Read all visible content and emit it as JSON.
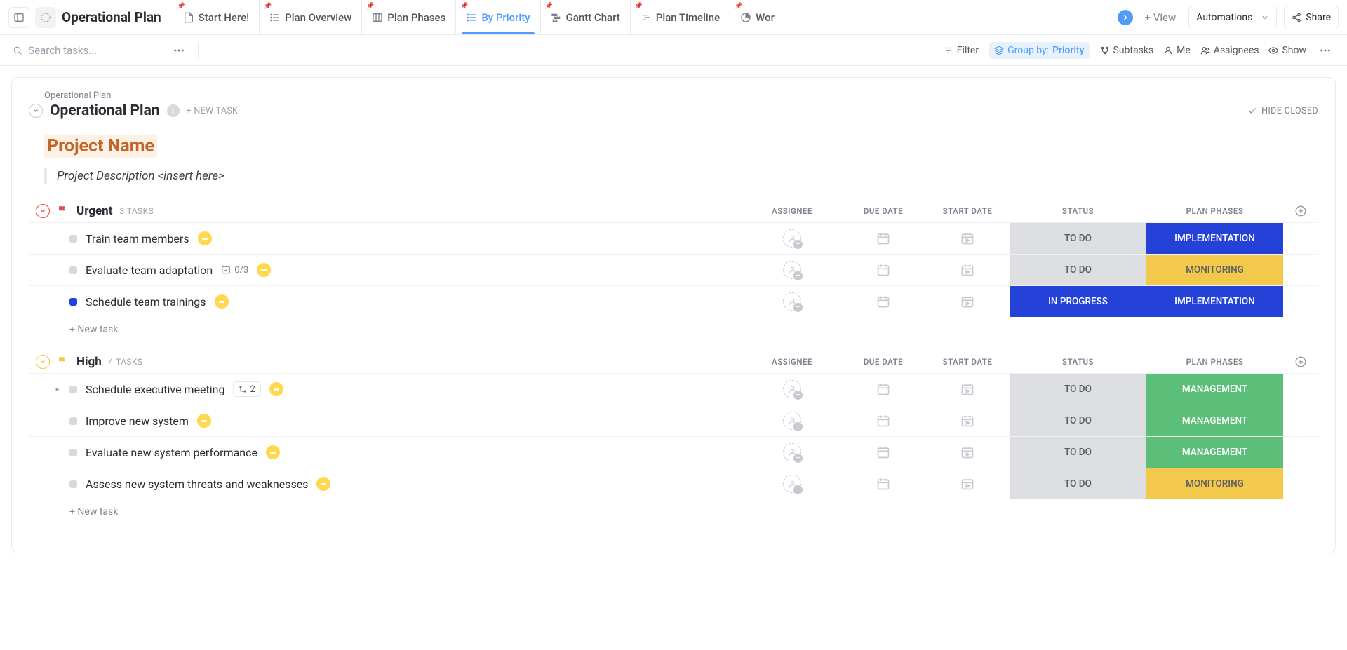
{
  "space_title": "Operational Plan",
  "tabs": [
    {
      "label": "Start Here!"
    },
    {
      "label": "Plan Overview"
    },
    {
      "label": "Plan Phases"
    },
    {
      "label": "By Priority"
    },
    {
      "label": "Gantt Chart"
    },
    {
      "label": "Plan Timeline"
    },
    {
      "label": "Wor"
    }
  ],
  "view_add": "View",
  "automations": "Automations",
  "share": "Share",
  "search_placeholder": "Search tasks...",
  "toolbar": {
    "filter": "Filter",
    "group_by_label": "Group by:",
    "group_by_value": "Priority",
    "subtasks": "Subtasks",
    "me": "Me",
    "assignees": "Assignees",
    "show": "Show"
  },
  "breadcrumb": "Operational Plan",
  "list_title": "Operational Plan",
  "new_task_header": "+ NEW TASK",
  "hide_closed": "HIDE CLOSED",
  "project_name": "Project Name",
  "project_desc": "Project Description <insert here>",
  "columns": {
    "assignee": "ASSIGNEE",
    "due": "DUE DATE",
    "start": "START DATE",
    "status": "STATUS",
    "phase": "PLAN PHASES"
  },
  "groups": [
    {
      "id": "urgent",
      "name": "Urgent",
      "count_label": "3 TASKS",
      "flag_color": "#e04f4f",
      "rows": [
        {
          "name": "Train team members",
          "sq": "grey",
          "status": "TO DO",
          "status_cls": "todo",
          "phase": "IMPLEMENTATION",
          "phase_cls": "impl"
        },
        {
          "name": "Evaluate team adaptation",
          "sq": "grey",
          "sub_ind": "0/3",
          "status": "TO DO",
          "status_cls": "todo",
          "phase": "MONITORING",
          "phase_cls": "mon"
        },
        {
          "name": "Schedule team trainings",
          "sq": "blue",
          "status": "IN PROGRESS",
          "status_cls": "prog",
          "phase": "IMPLEMENTATION",
          "phase_cls": "impl"
        }
      ]
    },
    {
      "id": "high",
      "name": "High",
      "count_label": "4 TASKS",
      "flag_color": "#f3c94b",
      "rows": [
        {
          "name": "Schedule executive meeting",
          "sq": "grey",
          "caret": true,
          "sub_badge": "2",
          "status": "TO DO",
          "status_cls": "todo",
          "phase": "MANAGEMENT",
          "phase_cls": "mgmt"
        },
        {
          "name": "Improve new system",
          "sq": "grey",
          "status": "TO DO",
          "status_cls": "todo",
          "phase": "MANAGEMENT",
          "phase_cls": "mgmt"
        },
        {
          "name": "Evaluate new system performance",
          "sq": "grey",
          "status": "TO DO",
          "status_cls": "todo",
          "phase": "MANAGEMENT",
          "phase_cls": "mgmt"
        },
        {
          "name": "Assess new system threats and weaknesses",
          "sq": "grey",
          "status": "TO DO",
          "status_cls": "todo",
          "phase": "MONITORING",
          "phase_cls": "mon"
        }
      ]
    }
  ],
  "new_task_row": "+ New task"
}
